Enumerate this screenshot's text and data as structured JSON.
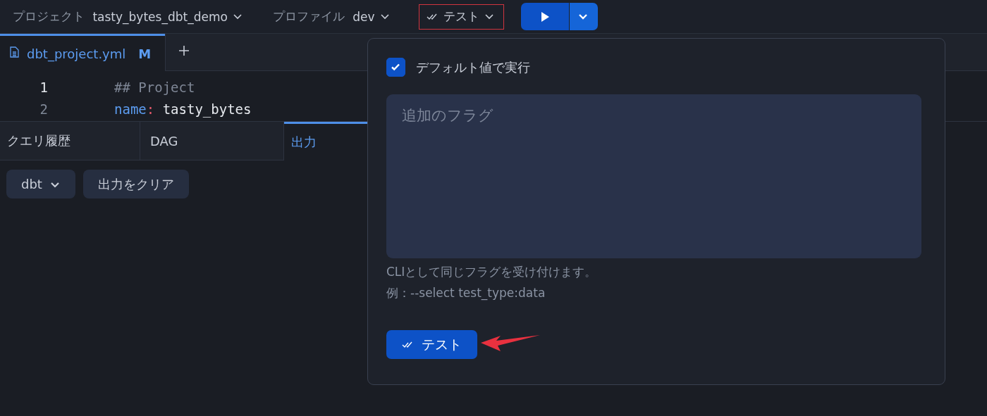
{
  "toolbar": {
    "project": {
      "label": "プロジェクト",
      "value": "tasty_bytes_dbt_demo"
    },
    "profile": {
      "label": "プロファイル",
      "value": "dev"
    },
    "command": {
      "label": "テスト",
      "highlighted": true
    }
  },
  "editor_tabs": [
    {
      "label": "dbt_project.yml",
      "badge": "M",
      "selected": true
    }
  ],
  "code_lines": [
    {
      "number": "1",
      "current": true,
      "tokens": [
        {
          "kind": "comment",
          "text": "## Project"
        }
      ]
    },
    {
      "number": "2",
      "current": false,
      "tokens": [
        {
          "kind": "key",
          "text": "name"
        },
        {
          "kind": "punct",
          "text": ":"
        },
        {
          "kind": "plain",
          "text": " tasty_bytes"
        }
      ]
    }
  ],
  "panel_tabs": [
    {
      "label": "クエリ履歴",
      "selected": false
    },
    {
      "label": "DAG",
      "selected": false
    },
    {
      "label": "出力",
      "selected": true
    }
  ],
  "output_toolbar": {
    "source": "dbt",
    "clear": "出力をクリア"
  },
  "popover": {
    "default_checkbox": {
      "label": "デフォルト値で実行",
      "checked": true
    },
    "flags_field": {
      "placeholder": "追加のフラグ"
    },
    "help": [
      "CLIとして同じフラグを受け付けます。",
      "例：--select test_type:data"
    ],
    "submit": "テスト",
    "arrow_annotation": true
  }
}
